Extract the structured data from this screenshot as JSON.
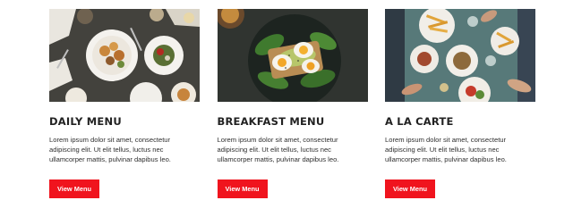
{
  "colors": {
    "accent": "#f0141e",
    "title": "#222222",
    "text": "#2f2f2f",
    "background": "#ffffff"
  },
  "menus": [
    {
      "title": "DAILY MENU",
      "description": "Lorem ipsum dolor sit amet, consectetur adipiscing elit. Ut elit tellus, luctus nec ullamcorper mattis, pulvinar dapibus leo.",
      "button_label": "View Menu",
      "photo": "dinner-table-plates-photo"
    },
    {
      "title": "BREAKFAST MENU",
      "description": "Lorem ipsum dolor sit amet, consectetur adipiscing elit. Ut elit tellus, luctus nec ullamcorper mattis, pulvinar dapibus leo.",
      "button_label": "View Menu",
      "photo": "egg-avocado-toast-photo"
    },
    {
      "title": "A LA CARTE",
      "description": "Lorem ipsum dolor sit amet, consectetur adipiscing elit. Ut elit tellus, luctus nec ullamcorper mattis, pulvinar dapibus leo.",
      "button_label": "View Menu",
      "photo": "shared-dishes-table-photo"
    }
  ]
}
